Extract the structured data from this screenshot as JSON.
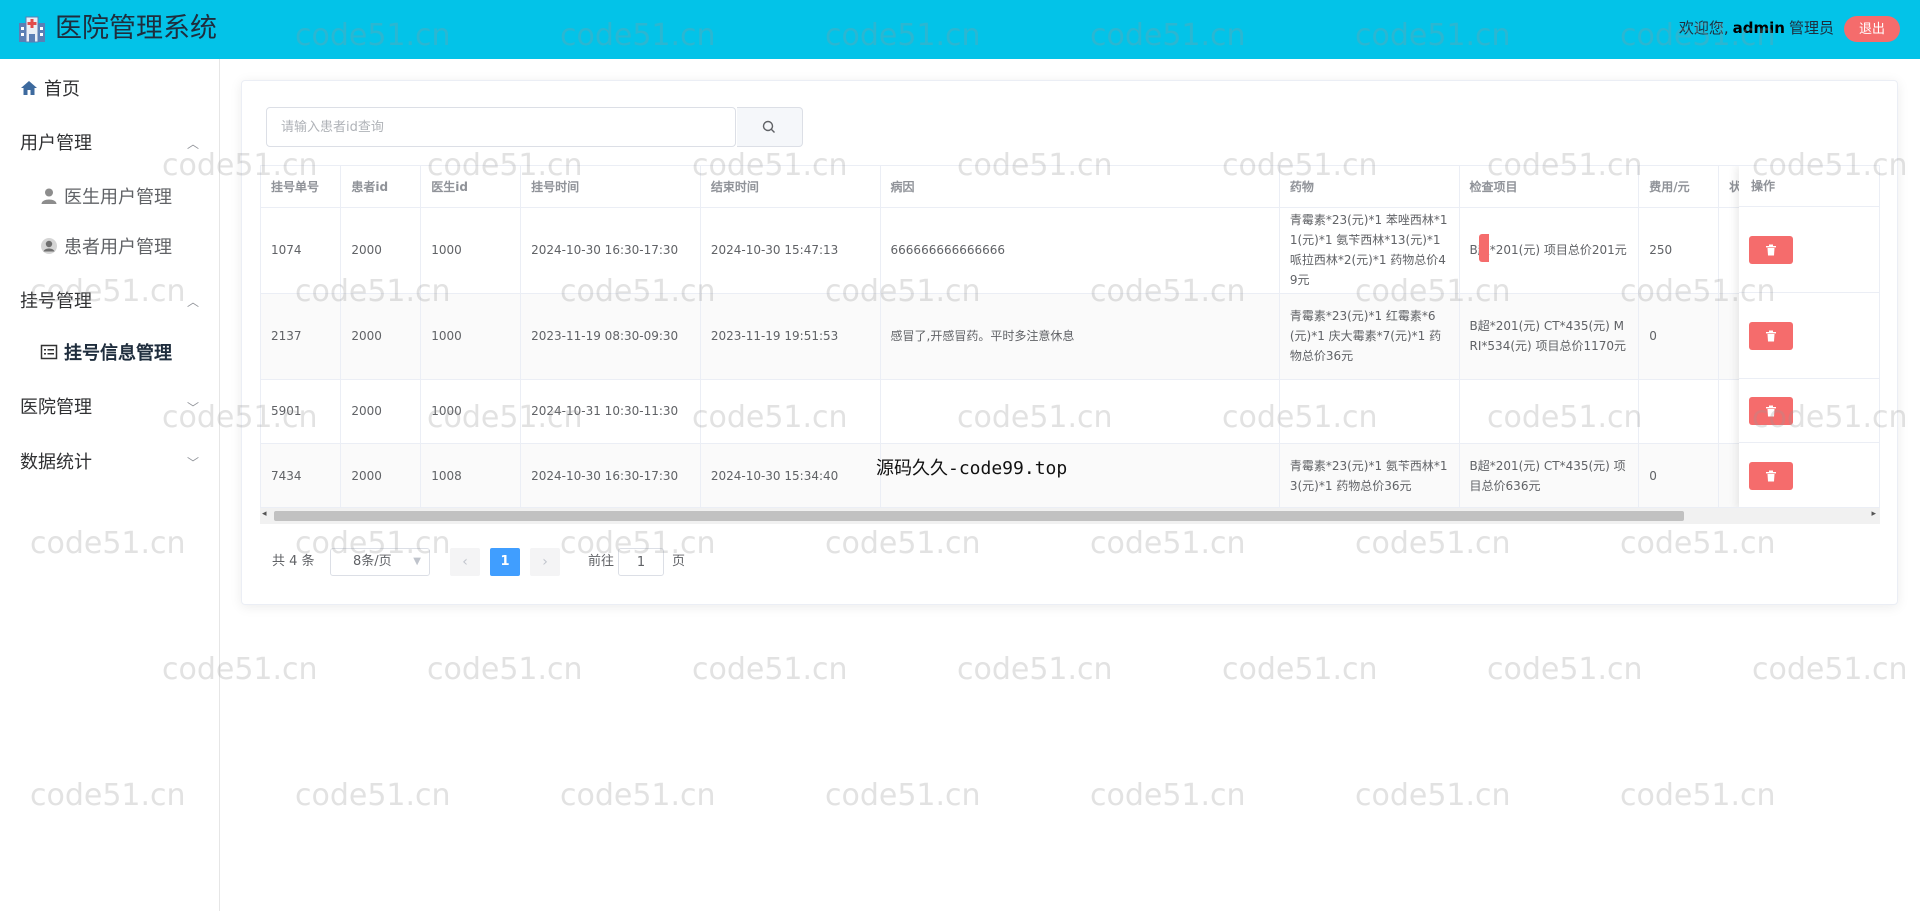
{
  "header": {
    "title": "医院管理系统",
    "welcome_prefix": "欢迎您,",
    "username": "admin",
    "role": "管理员",
    "logout_label": "退出",
    "bg_color": "#03c3e8"
  },
  "sidebar": {
    "home": {
      "label": "首页",
      "icon": "home-icon"
    },
    "groups": [
      {
        "label": "用户管理",
        "expanded": true,
        "children": [
          {
            "label": "医生用户管理",
            "icon": "user-icon"
          },
          {
            "label": "患者用户管理",
            "icon": "user-circle-icon"
          }
        ]
      },
      {
        "label": "挂号管理",
        "expanded": true,
        "children": [
          {
            "label": "挂号信息管理",
            "icon": "list-icon",
            "active": true
          }
        ]
      },
      {
        "label": "医院管理",
        "expanded": false
      },
      {
        "label": "数据统计",
        "expanded": false
      }
    ]
  },
  "search": {
    "placeholder": "请输入患者id查询",
    "value": ""
  },
  "table": {
    "columns": [
      "挂号单号",
      "患者id",
      "医生id",
      "挂号时间",
      "结束时间",
      "病因",
      "药物",
      "检查项目",
      "费用/元",
      "状",
      "操作"
    ],
    "rows": [
      {
        "id": "1074",
        "patient": "2000",
        "doctor": "1000",
        "reg_time": "2024-10-30 16:30-17:30",
        "end_time": "2024-10-30 15:47:13",
        "cause": "666666666666666",
        "drugs": "青霉素*23(元)*1 苯唑西林*11(元)*1 氨苄西林*13(元)*1 哌拉西林*2(元)*1 药物总价49元",
        "exams": "B超*201(元) 项目总价201元",
        "fee": "250"
      },
      {
        "id": "2137",
        "patient": "2000",
        "doctor": "1000",
        "reg_time": "2023-11-19 08:30-09:30",
        "end_time": "2023-11-19 19:51:53",
        "cause": "感冒了,开感冒药。平时多注意休息",
        "drugs": "青霉素*23(元)*1 红霉素*6(元)*1 庆大霉素*7(元)*1 药物总价36元",
        "exams": "B超*201(元) CT*435(元) MRI*534(元) 项目总价1170元",
        "fee": "0"
      },
      {
        "id": "5901",
        "patient": "2000",
        "doctor": "1000",
        "reg_time": "2024-10-31 10:30-11:30",
        "end_time": "",
        "cause": "",
        "drugs": "",
        "exams": "",
        "fee": ""
      },
      {
        "id": "7434",
        "patient": "2000",
        "doctor": "1008",
        "reg_time": "2024-10-30 16:30-17:30",
        "end_time": "2024-10-30 15:34:40",
        "cause": "",
        "drugs": "青霉素*23(元)*1 氨苄西林*13(元)*1 药物总价36元",
        "exams": "B超*201(元) CT*435(元) 项目总价636元",
        "fee": "0"
      }
    ]
  },
  "pagination": {
    "total_text": "共 4 条",
    "page_size": "8条/页",
    "current_page": "1",
    "goto_label": "前往",
    "goto_value": "1",
    "page_suffix": "页"
  },
  "watermark": {
    "text": "code51.cn",
    "overlay": "源码久久-code99.top"
  },
  "colors": {
    "danger": "#f56c6c",
    "primary": "#409eff"
  }
}
